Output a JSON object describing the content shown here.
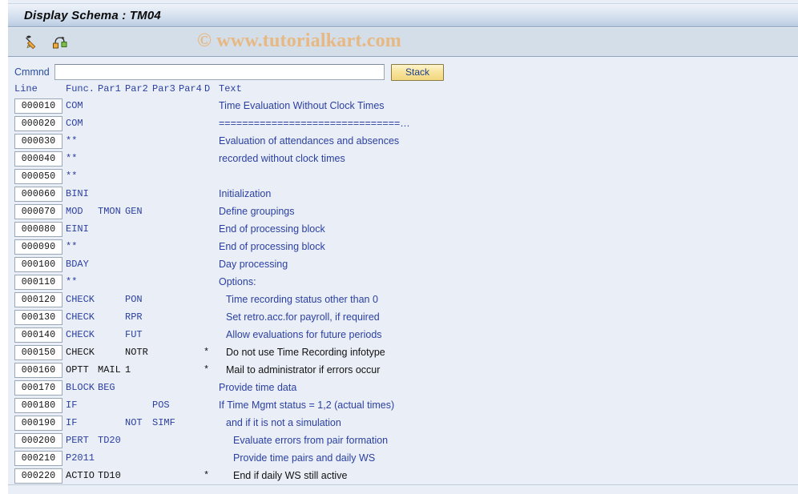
{
  "window": {
    "title": "Display Schema : TM04"
  },
  "watermark": {
    "text": "© www.tutorialkart.com"
  },
  "toolbar": {
    "icons": [
      {
        "name": "edit-pencil-icon",
        "label": "Change"
      },
      {
        "name": "hierarchy-node-icon",
        "label": "Subschema"
      }
    ]
  },
  "command_bar": {
    "label": "Cmmnd",
    "value": "",
    "placeholder": "",
    "stack_label": "Stack"
  },
  "columns": {
    "line": "Line",
    "func": "Func.",
    "par1": "Par1",
    "par2": "Par2",
    "par3": "Par3",
    "par4": "Par4",
    "d": "D",
    "text": "Text"
  },
  "colors": {
    "active_text": "#2b3fa0",
    "inactive_text": "#111111",
    "title_bar": "#c3d3e6",
    "toolbar": "#d3dee9",
    "page_bg": "#eaeff7",
    "button_accent": "#f2d77f",
    "watermark": "#e8b882"
  },
  "rows": [
    {
      "line": "000010",
      "func": "COM",
      "par1": "",
      "par2": "",
      "par3": "",
      "par4": "",
      "d": "",
      "text": "Time Evaluation Without Clock Times",
      "indent": 0,
      "active": true
    },
    {
      "line": "000020",
      "func": "COM",
      "par1": "",
      "par2": "",
      "par3": "",
      "par4": "",
      "d": "",
      "text": "===============================…",
      "indent": 0,
      "active": true
    },
    {
      "line": "000030",
      "func": "**",
      "par1": "",
      "par2": "",
      "par3": "",
      "par4": "",
      "d": "",
      "text": "Evaluation of attendances and absences",
      "indent": 0,
      "active": true
    },
    {
      "line": "000040",
      "func": "**",
      "par1": "",
      "par2": "",
      "par3": "",
      "par4": "",
      "d": "",
      "text": "recorded without clock times",
      "indent": 0,
      "active": true
    },
    {
      "line": "000050",
      "func": "**",
      "par1": "",
      "par2": "",
      "par3": "",
      "par4": "",
      "d": "",
      "text": "",
      "indent": 0,
      "active": true
    },
    {
      "line": "000060",
      "func": "BINI",
      "par1": "",
      "par2": "",
      "par3": "",
      "par4": "",
      "d": "",
      "text": "Initialization",
      "indent": 0,
      "active": true
    },
    {
      "line": "000070",
      "func": "MOD",
      "par1": "TMON",
      "par2": "GEN",
      "par3": "",
      "par4": "",
      "d": "",
      "text": "Define groupings",
      "indent": 0,
      "active": true
    },
    {
      "line": "000080",
      "func": "EINI",
      "par1": "",
      "par2": "",
      "par3": "",
      "par4": "",
      "d": "",
      "text": "End of processing block",
      "indent": 0,
      "active": true
    },
    {
      "line": "000090",
      "func": "**",
      "par1": "",
      "par2": "",
      "par3": "",
      "par4": "",
      "d": "",
      "text": "End of processing block",
      "indent": 0,
      "active": true
    },
    {
      "line": "000100",
      "func": "BDAY",
      "par1": "",
      "par2": "",
      "par3": "",
      "par4": "",
      "d": "",
      "text": "Day processing",
      "indent": 0,
      "active": true
    },
    {
      "line": "000110",
      "func": "**",
      "par1": "",
      "par2": "",
      "par3": "",
      "par4": "",
      "d": "",
      "text": "Options:",
      "indent": 0,
      "active": true
    },
    {
      "line": "000120",
      "func": "CHECK",
      "par1": "",
      "par2": "PON",
      "par3": "",
      "par4": "",
      "d": "",
      "text": "Time recording status other than 0",
      "indent": 1,
      "active": true
    },
    {
      "line": "000130",
      "func": "CHECK",
      "par1": "",
      "par2": "RPR",
      "par3": "",
      "par4": "",
      "d": "",
      "text": "Set retro.acc.for payroll, if required",
      "indent": 1,
      "active": true
    },
    {
      "line": "000140",
      "func": "CHECK",
      "par1": "",
      "par2": "FUT",
      "par3": "",
      "par4": "",
      "d": "",
      "text": "Allow evaluations for future periods",
      "indent": 1,
      "active": true
    },
    {
      "line": "000150",
      "func": "CHECK",
      "par1": "",
      "par2": "NOTR",
      "par3": "",
      "par4": "",
      "d": "*",
      "text": "Do not use Time Recording infotype",
      "indent": 1,
      "active": false
    },
    {
      "line": "000160",
      "func": "OPTT",
      "par1": "MAIL",
      "par2": "1",
      "par3": "",
      "par4": "",
      "d": "*",
      "text": "Mail to administrator if errors occur",
      "indent": 1,
      "active": false
    },
    {
      "line": "000170",
      "func": "BLOCK",
      "par1": "BEG",
      "par2": "",
      "par3": "",
      "par4": "",
      "d": "",
      "text": "Provide time data",
      "indent": 0,
      "active": true
    },
    {
      "line": "000180",
      "func": "IF",
      "par1": "",
      "par2": "",
      "par3": "POS",
      "par4": "",
      "d": "",
      "text": "If Time Mgmt status = 1,2 (actual times)",
      "indent": 0,
      "active": true
    },
    {
      "line": "000190",
      "func": "IF",
      "par1": "",
      "par2": "NOT",
      "par3": "SIMF",
      "par4": "",
      "d": "",
      "text": "and if it is not a simulation",
      "indent": 1,
      "active": true
    },
    {
      "line": "000200",
      "func": "PERT",
      "par1": "TD20",
      "par2": "",
      "par3": "",
      "par4": "",
      "d": "",
      "text": "Evaluate errors from pair formation",
      "indent": 2,
      "active": true
    },
    {
      "line": "000210",
      "func": "P2011",
      "par1": "",
      "par2": "",
      "par3": "",
      "par4": "",
      "d": "",
      "text": "Provide time pairs and daily WS",
      "indent": 2,
      "active": true
    },
    {
      "line": "000220",
      "func": "ACTIO",
      "par1": "TD10",
      "par2": "",
      "par3": "",
      "par4": "",
      "d": "*",
      "text": "End if daily WS still active",
      "indent": 2,
      "active": false
    }
  ]
}
